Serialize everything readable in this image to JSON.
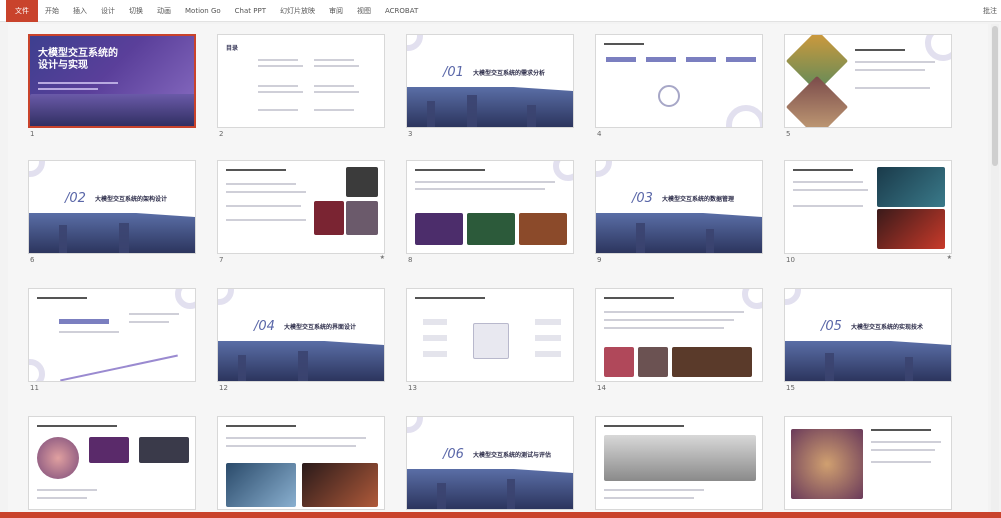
{
  "ribbon": {
    "tabs": [
      "文件",
      "开始",
      "插入",
      "设计",
      "切换",
      "动画",
      "Motion Go",
      "Chat PPT",
      "幻灯片放映",
      "审阅",
      "视图",
      "ACROBAT"
    ],
    "active_index": 0,
    "right_label": "批注"
  },
  "slides": {
    "numbers": [
      "1",
      "2",
      "3",
      "4",
      "5",
      "6",
      "7",
      "8",
      "9",
      "10",
      "11",
      "12",
      "13",
      "14",
      "15"
    ],
    "title_slide": [
      "大模型交互系统的",
      "设计与实现"
    ],
    "toc_label": "目录",
    "sections": [
      {
        "num": "/01",
        "title": "大模型交互系统的需求分析"
      },
      {
        "num": "/02",
        "title": "大模型交互系统的架构设计"
      },
      {
        "num": "/03",
        "title": "大模型交互系统的数据管理"
      },
      {
        "num": "/04",
        "title": "大模型交互系统的界面设计"
      },
      {
        "num": "/05",
        "title": "大模型交互系统的实现技术"
      },
      {
        "num": "/06",
        "title": "大模型交互系统的测试与评估"
      }
    ]
  },
  "colors": {
    "accent": "#c9432c",
    "section_num": "#5a67a8"
  }
}
